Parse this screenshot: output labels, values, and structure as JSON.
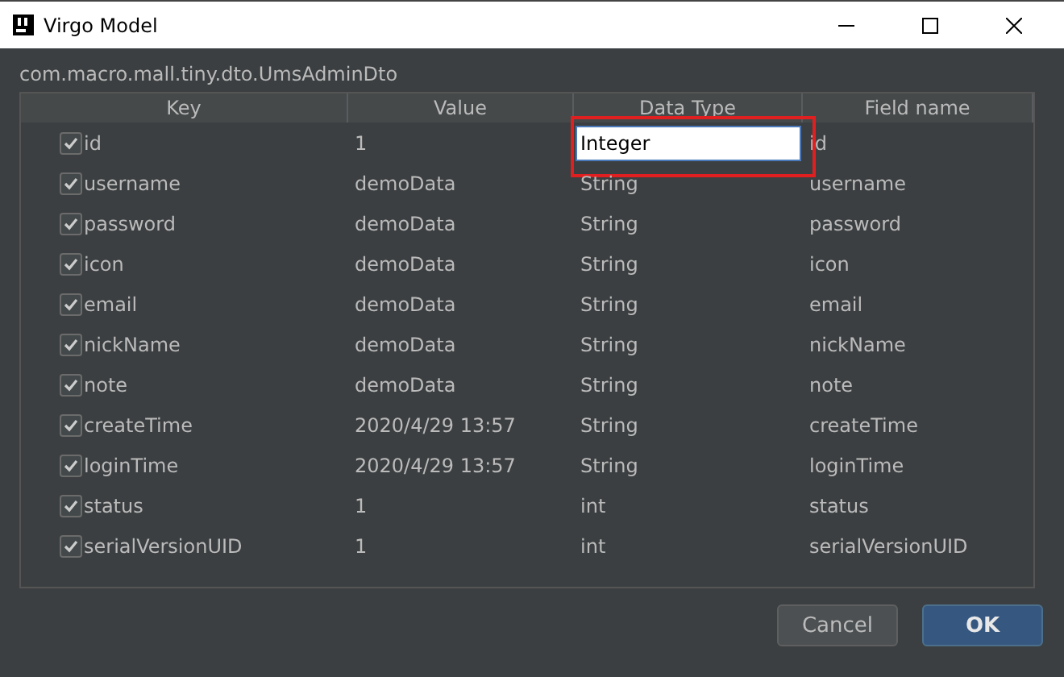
{
  "window": {
    "title": "Virgo Model"
  },
  "class_name": "com.macro.mall.tiny.dto.UmsAdminDto",
  "table": {
    "columns": [
      "Key",
      "Value",
      "Data Type",
      "Field name"
    ],
    "rows": [
      {
        "key": "id",
        "checked": true,
        "value": "1",
        "data_type": "Integer",
        "field_name": "id",
        "editing": true
      },
      {
        "key": "username",
        "checked": true,
        "value": "demoData",
        "data_type": "String",
        "field_name": "username",
        "editing": false
      },
      {
        "key": "password",
        "checked": true,
        "value": "demoData",
        "data_type": "String",
        "field_name": "password",
        "editing": false
      },
      {
        "key": "icon",
        "checked": true,
        "value": "demoData",
        "data_type": "String",
        "field_name": "icon",
        "editing": false
      },
      {
        "key": "email",
        "checked": true,
        "value": "demoData",
        "data_type": "String",
        "field_name": "email",
        "editing": false
      },
      {
        "key": "nickName",
        "checked": true,
        "value": "demoData",
        "data_type": "String",
        "field_name": "nickName",
        "editing": false
      },
      {
        "key": "note",
        "checked": true,
        "value": "demoData",
        "data_type": "String",
        "field_name": "note",
        "editing": false
      },
      {
        "key": "createTime",
        "checked": true,
        "value": "2020/4/29 13:57",
        "data_type": "String",
        "field_name": "createTime",
        "editing": false
      },
      {
        "key": "loginTime",
        "checked": true,
        "value": "2020/4/29 13:57",
        "data_type": "String",
        "field_name": "loginTime",
        "editing": false
      },
      {
        "key": "status",
        "checked": true,
        "value": "1",
        "data_type": "int",
        "field_name": "status",
        "editing": false
      },
      {
        "key": "serialVersionUID",
        "checked": true,
        "value": "1",
        "data_type": "int",
        "field_name": "serialVersionUID",
        "editing": false
      }
    ]
  },
  "buttons": [
    {
      "label": "Cancel",
      "kind": "secondary"
    },
    {
      "label": "OK",
      "kind": "primary"
    }
  ]
}
